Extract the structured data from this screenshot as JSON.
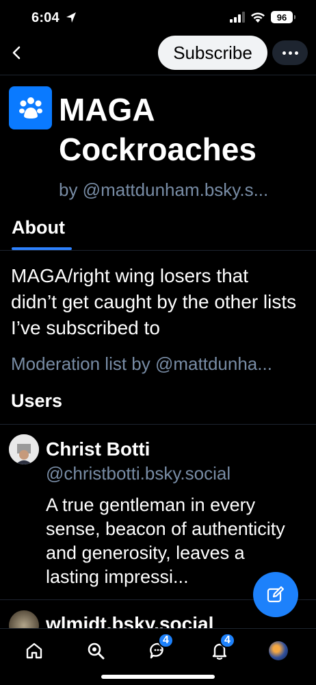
{
  "status_bar": {
    "time": "6:04",
    "battery": "96"
  },
  "header": {
    "subscribe_label": "Subscribe"
  },
  "list": {
    "title": "MAGA Cockroaches",
    "owner": "by @mattdunham.bsky.s...",
    "avatar_icon": "users-group-icon",
    "accent_color": "#0a7aff"
  },
  "tabs": [
    {
      "label": "About",
      "active": true
    }
  ],
  "about": {
    "description": "MAGA/right wing losers that didn’t get caught by the other lists I’ve subscribed to",
    "moderation_line": "Moderation list by @mattdunha..."
  },
  "users_heading": "Users",
  "users": [
    {
      "name": "Christ Botti",
      "handle": "@christbotti.bsky.social",
      "bio": "A true gentleman in every sense, beacon of authenticity and generosity, leaves a lasting impressi..."
    },
    {
      "name": "wlmidt.bsky.social"
    }
  ],
  "bottom_nav": {
    "items": [
      {
        "name": "home",
        "icon": "home-icon"
      },
      {
        "name": "search",
        "icon": "search-icon"
      },
      {
        "name": "messages",
        "icon": "chat-icon",
        "badge": "4"
      },
      {
        "name": "notifications",
        "icon": "bell-icon",
        "badge": "4"
      },
      {
        "name": "profile",
        "icon": "avatar"
      }
    ]
  },
  "colors": {
    "background": "#000000",
    "link_grey": "#788ca5",
    "brand_blue": "#1d81fb",
    "divider": "#1e2530"
  }
}
